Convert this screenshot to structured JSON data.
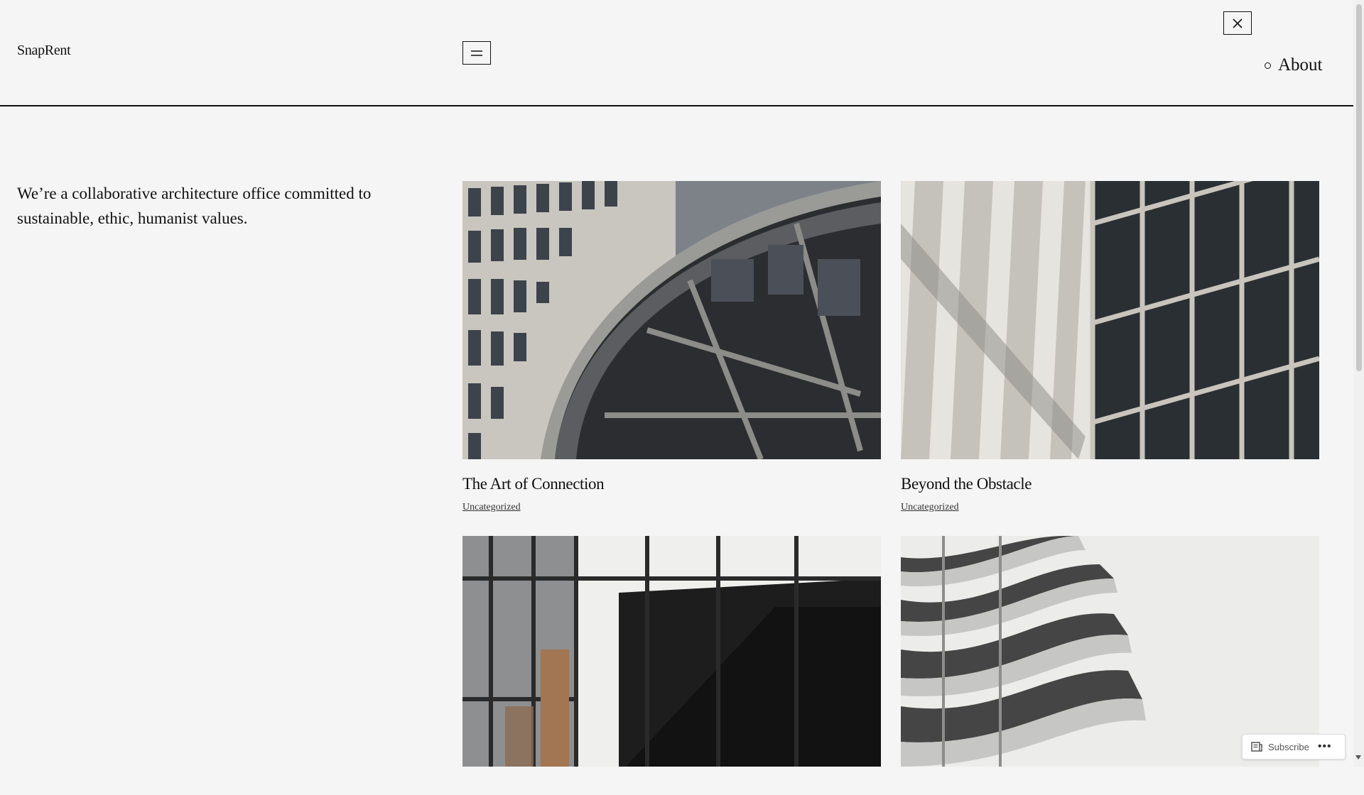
{
  "site": {
    "title": "SnapRent"
  },
  "nav": {
    "items": [
      {
        "label": "About"
      }
    ]
  },
  "tagline": "We’re a collaborative architecture office committed to sustainable, ethic, humanist values.",
  "posts": [
    {
      "title": "The Art of Connection",
      "category": "Uncategorized"
    },
    {
      "title": "Beyond the Obstacle",
      "category": "Uncategorized"
    },
    {
      "title": "",
      "category": ""
    },
    {
      "title": "",
      "category": ""
    }
  ],
  "subscribe": {
    "label": "Subscribe",
    "more": "•••"
  },
  "icons": {
    "menu": "hamburger-icon",
    "close": "close-icon",
    "subscribe": "reader-icon"
  }
}
